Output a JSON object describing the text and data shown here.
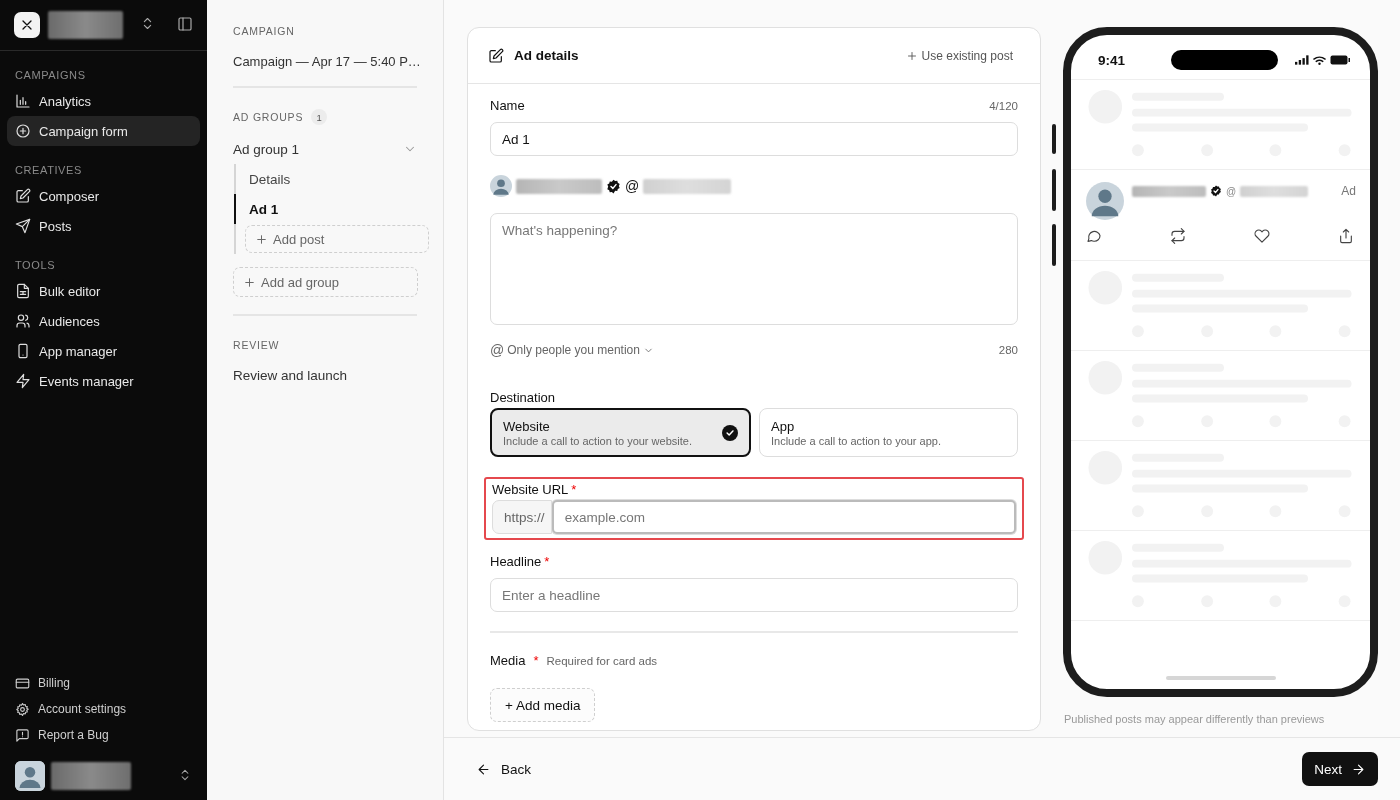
{
  "sidebar": {
    "sections": [
      {
        "heading": "CAMPAIGNS",
        "items": [
          {
            "label": "Analytics",
            "selected": false
          },
          {
            "label": "Campaign form",
            "selected": true
          }
        ]
      },
      {
        "heading": "CREATIVES",
        "items": [
          {
            "label": "Composer",
            "selected": false
          },
          {
            "label": "Posts",
            "selected": false
          }
        ]
      },
      {
        "heading": "TOOLS",
        "items": [
          {
            "label": "Bulk editor",
            "selected": false
          },
          {
            "label": "Audiences",
            "selected": false
          },
          {
            "label": "App manager",
            "selected": false
          },
          {
            "label": "Events manager",
            "selected": false
          }
        ]
      }
    ],
    "footer_items": [
      {
        "label": "Billing"
      },
      {
        "label": "Account settings"
      },
      {
        "label": "Report a Bug"
      }
    ]
  },
  "steps": {
    "campaign": {
      "heading": "CAMPAIGN",
      "name": "Campaign — Apr 17 — 5:40 P…"
    },
    "ad_groups": {
      "heading": "AD GROUPS",
      "count": "1",
      "groups": [
        {
          "label": "Ad group 1",
          "expanded": true,
          "children": [
            {
              "label": "Details",
              "selected": false
            },
            {
              "label": "Ad 1",
              "selected": true
            }
          ],
          "add_button": "Add post"
        }
      ],
      "add_button": "Add ad group"
    },
    "review": {
      "heading": "REVIEW",
      "items": [
        {
          "label": "Review and launch",
          "selected": false
        }
      ]
    }
  },
  "form": {
    "title": "Ad details",
    "header_action": "Use existing post",
    "name": {
      "label": "Name",
      "counter": "4/120",
      "value": "Ad 1"
    },
    "account": {
      "at": "@",
      "verified": true
    },
    "post_text": {
      "placeholder": "What's happening?"
    },
    "reply_setting": {
      "mark": "@",
      "label": "Only people you mention",
      "remaining": "280"
    },
    "destination": {
      "label": "Destination",
      "options": [
        {
          "title": "Website",
          "description": "Include a call to action to your website.",
          "selected": true
        },
        {
          "title": "App",
          "description": "Include a call to action to your app.",
          "selected": false
        }
      ]
    },
    "website_url": {
      "label": "Website URL",
      "required_mark": "*",
      "prefix": "https://",
      "placeholder": "example.com",
      "highlighted": true,
      "focused": true
    },
    "headline": {
      "label": "Headline",
      "required_mark": "*",
      "placeholder": "Enter a headline"
    },
    "media": {
      "label": "Media",
      "required_mark": "*",
      "hint": "Required for card ads",
      "button": "+ Add media"
    }
  },
  "preview": {
    "time": "9:41",
    "ad_post": {
      "at": "@",
      "verified": true,
      "badge": "Ad"
    },
    "note": "Published posts may appear differently than previews"
  },
  "footer": {
    "back": "Back",
    "next": "Next"
  }
}
